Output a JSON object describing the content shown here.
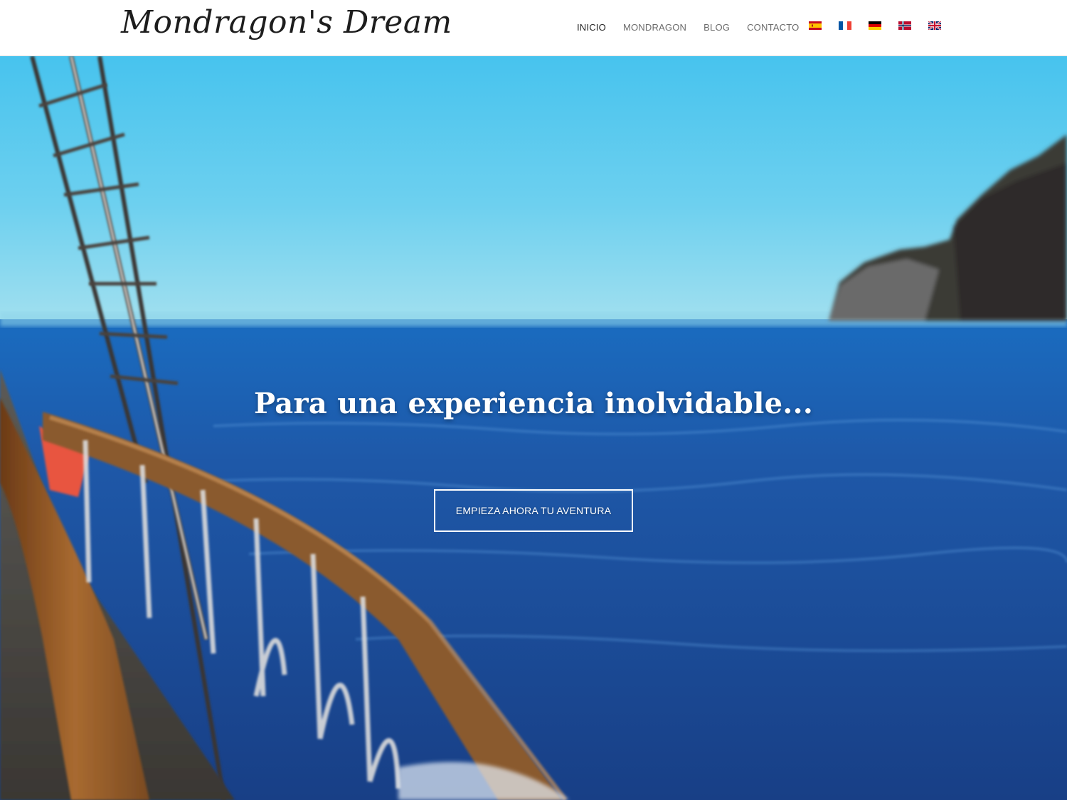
{
  "header": {
    "logo_text": "Mondragon's Dream",
    "nav": [
      {
        "label": "INICIO",
        "active": true
      },
      {
        "label": "MONDRAGON",
        "active": false
      },
      {
        "label": "BLOG",
        "active": false
      },
      {
        "label": "CONTACTO",
        "active": false
      }
    ],
    "languages": [
      {
        "code": "es",
        "icon": "spain-flag-icon"
      },
      {
        "code": "fr",
        "icon": "france-flag-icon"
      },
      {
        "code": "de",
        "icon": "germany-flag-icon"
      },
      {
        "code": "no",
        "icon": "norway-flag-icon"
      },
      {
        "code": "en",
        "icon": "uk-flag-icon"
      }
    ]
  },
  "hero": {
    "headline": "Para una experiencia inolvidable...",
    "cta_label": "EMPIEZA AHORA TU AVENTURA"
  },
  "colors": {
    "sky_top": "#4cc4ec",
    "sea": "#1f5fb0",
    "cliff": "#3b3a35",
    "deck_wood": "#8a5a2e",
    "cta_border": "#ffffff"
  }
}
